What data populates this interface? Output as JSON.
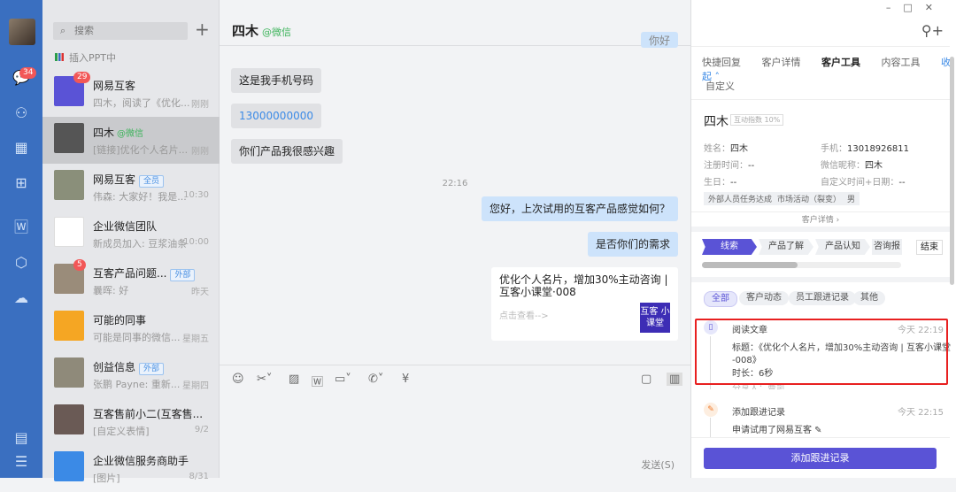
{
  "nav": {
    "badge": "34",
    "icons": [
      "avatar",
      "chat-icon",
      "org-icon",
      "calendar-icon",
      "apps-icon",
      "doc-icon",
      "hexagon-icon",
      "cloud-icon",
      "note-icon",
      "menu-icon"
    ]
  },
  "list": {
    "search_placeholder": "搜索",
    "ppt": "插入PPT中",
    "items": [
      {
        "name": "网易互客",
        "preview": "四木，阅读了《优化...",
        "time": "刚刚",
        "badge": "29",
        "color": "#5a53d6"
      },
      {
        "name": "四木",
        "wx": "@微信",
        "preview": "[链接]优化个人名片...",
        "time": "刚刚",
        "color": "#555"
      },
      {
        "name": "网易互客",
        "tag": "全员",
        "preview": "伟森: 大家好！我是...",
        "time": "10:30",
        "color": "#8a8f7a"
      },
      {
        "name": "企业微信团队",
        "preview": "新成员加入: 豆浆油条",
        "time": "10:00",
        "color": "#ffffff"
      },
      {
        "name": "互客产品问题...",
        "tag": "外部",
        "preview": "曩晖: 好",
        "time": "昨天",
        "badge": "5",
        "color": "#9a8c7a"
      },
      {
        "name": "可能的同事",
        "preview": "可能是同事的微信...",
        "time": "星期五",
        "color": "#f5a623"
      },
      {
        "name": "创益信息",
        "tag": "外部",
        "preview": "张鹏  Payne: 重新...",
        "time": "星期四",
        "color": "#8f8a7a"
      },
      {
        "name": "互客售前小二(互客售...",
        "preview": "[自定义表情]",
        "time": "9/2",
        "color": "#6a5a55"
      },
      {
        "name": "企业微信服务商助手",
        "preview": "[图片]",
        "time": "8/31",
        "color": "#3b8ae6"
      }
    ]
  },
  "chat": {
    "title": "四木",
    "source": "@微信",
    "top_msg": "你好",
    "msgs_left": [
      "这是我手机号码",
      "13000000000",
      "你们产品我很感兴趣"
    ],
    "time": "22:16",
    "msgs_right": [
      "您好，上次试用的互客产品感觉如何？",
      "是否你们的需求"
    ],
    "card": {
      "title": "优化个人名片，增加30%主动咨询 | 互客小课堂·008",
      "link": "点击查看-->",
      "thumb": "互客 小课堂"
    },
    "send": "发送(S)"
  },
  "panel": {
    "tabs": [
      "快捷回复",
      "客户详情",
      "客户工具",
      "内容工具"
    ],
    "collapse": "收起 ˄",
    "custom": "自定义",
    "name": "四木",
    "index": "互动指数 10%",
    "fields": [
      [
        "姓名：",
        "四木"
      ],
      [
        "手机：",
        "13018926811"
      ],
      [
        "注册时间：",
        "--"
      ],
      [
        "微信昵称：",
        "四木"
      ],
      [
        "生日：",
        "--"
      ],
      [
        "自定义时间+日期：",
        "--"
      ]
    ],
    "tags": [
      "外部人员任务达成",
      "市场活动（裂变）",
      "男"
    ],
    "detail": "客户详情 ›",
    "stages": [
      "线索",
      "产品了解",
      "产品认知",
      "咨询报"
    ],
    "end": "结束",
    "progress": 0.48,
    "filters": [
      "全部",
      "客户动态",
      "员工跟进记录",
      "其他"
    ],
    "events": [
      {
        "title": "阅读文章",
        "time": "今天 22:19",
        "line1": "标题：《优化个人名片，增加30%主动咨询 | 互客小课堂",
        "line2": "-008》",
        "line3": "时长：6秒",
        "line4": "分享人：曹凯"
      },
      {
        "title": "添加跟进记录",
        "time": "今天 22:15",
        "line1": "申请试用了网易互客 ✎"
      }
    ],
    "add": "添加跟进记录"
  },
  "colors": {
    "accent": "#5a53d6",
    "nav": "#3a6fc0",
    "highlight": "#e82020"
  }
}
